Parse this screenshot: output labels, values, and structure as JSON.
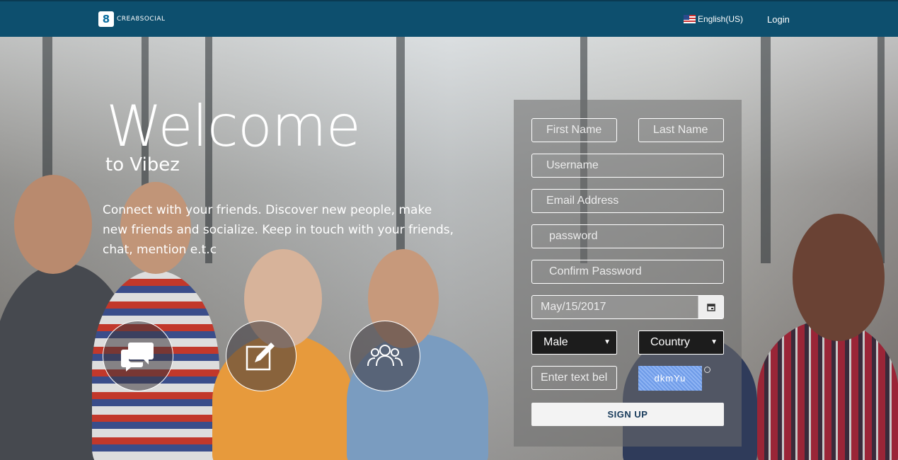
{
  "header": {
    "logo_text": "CREA8SOCIAL",
    "logo_mark": "8",
    "language": "English(US)",
    "login_label": "Login"
  },
  "hero": {
    "title": "Welcome",
    "subtitle": "to Vibez",
    "description": "Connect with your friends. Discover new people, make new friends and socialize. Keep in touch with your friends, chat, mention e.t.c",
    "features": [
      "chat-bubbles-icon",
      "edit-icon",
      "group-icon"
    ]
  },
  "form": {
    "first_name_placeholder": "First Name",
    "last_name_placeholder": "Last Name",
    "username_placeholder": "Username",
    "email_placeholder": "Email Address",
    "password_placeholder": "password",
    "confirm_password_placeholder": "Confirm Password",
    "birthdate_value": "May/15/2017",
    "gender_value": "Male",
    "country_value": "Country",
    "captcha_input_placeholder": "Enter text bel",
    "captcha_text": "dkmYu",
    "signup_label": "SIGN UP"
  },
  "colors": {
    "header_bg": "#0d4f6e",
    "captcha_bg": "#7aa6ee",
    "signup_text": "#173a5a"
  }
}
